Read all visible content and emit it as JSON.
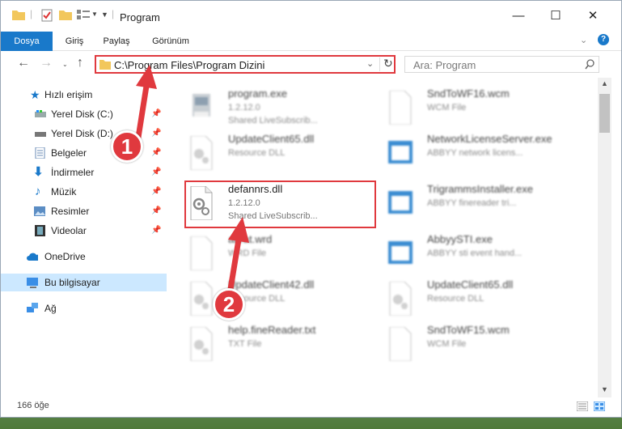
{
  "window": {
    "title": "Program"
  },
  "ribbon": {
    "tabs": [
      "Dosya",
      "Giriş",
      "Paylaş",
      "Görünüm"
    ]
  },
  "address": {
    "path": "C:\\Program Files\\Program Dizini"
  },
  "search": {
    "placeholder": "Ara: Program"
  },
  "nav": {
    "items": [
      {
        "label": "Hızlı erişim",
        "icon": "star-icon",
        "pinned": false
      },
      {
        "label": "Yerel Disk (C:)",
        "icon": "drive-icon",
        "pinned": true
      },
      {
        "label": "Yerel Disk (D:)",
        "icon": "drive-icon",
        "pinned": true
      },
      {
        "label": "Belgeler",
        "icon": "documents-icon",
        "pinned": true
      },
      {
        "label": "İndirmeler",
        "icon": "download-icon",
        "pinned": true
      },
      {
        "label": "Müzik",
        "icon": "music-icon",
        "pinned": true
      },
      {
        "label": "Resimler",
        "icon": "pictures-icon",
        "pinned": true
      },
      {
        "label": "Videolar",
        "icon": "video-icon",
        "pinned": true
      },
      {
        "label": "OneDrive",
        "icon": "cloud-icon",
        "pinned": false
      },
      {
        "label": "Bu bilgisayar",
        "icon": "computer-icon",
        "pinned": false
      },
      {
        "label": "Ağ",
        "icon": "network-icon",
        "pinned": false
      }
    ]
  },
  "files": [
    {
      "name": "program.exe",
      "l2": "1.2.12.0",
      "l3": "Shared LiveSubscrib...",
      "icon": "exe-icon"
    },
    {
      "name": "SndToWF16.wcm",
      "l2": "WCM File",
      "l3": "",
      "icon": "file-icon"
    },
    {
      "name": "UpdateClient65.dll",
      "l2": "Resource DLL",
      "l3": "",
      "icon": "dll-icon"
    },
    {
      "name": "NetworkLicenseServer.exe",
      "l2": "ABBYY network licens...",
      "l3": "",
      "icon": "exe-window-icon"
    },
    {
      "name": "defannrs.dll",
      "l2": "1.2.12.0",
      "l3": "Shared LiveSubscrib...",
      "icon": "dll-icon"
    },
    {
      "name": "TrigrammsInstaller.exe",
      "l2": "ABBYY finereader tri...",
      "l3": "",
      "icon": "exe-window-icon"
    },
    {
      "name": "abrat.wrd",
      "l2": "WRD File",
      "l3": "",
      "icon": "file-icon"
    },
    {
      "name": "AbbyySTI.exe",
      "l2": "ABBYY sti event hand...",
      "l3": "",
      "icon": "exe-window-icon"
    },
    {
      "name": "UpdateClient42.dll",
      "l2": "Resource DLL",
      "l3": "",
      "icon": "dll-icon"
    },
    {
      "name": "UpdateClient65.dll",
      "l2": "Resource DLL",
      "l3": "",
      "icon": "dll-icon"
    },
    {
      "name": "help.fineReader.txt",
      "l2": "TXT File",
      "l3": "",
      "icon": "dll-icon"
    },
    {
      "name": "SndToWF15.wcm",
      "l2": "WCM File",
      "l3": "",
      "icon": "file-icon"
    }
  ],
  "status": {
    "count": "166 öğe"
  },
  "annotations": {
    "step1": "1",
    "step2": "2"
  },
  "colors": {
    "accent": "#1979ca",
    "highlight": "#e0393e",
    "selected": "#cce8ff"
  }
}
